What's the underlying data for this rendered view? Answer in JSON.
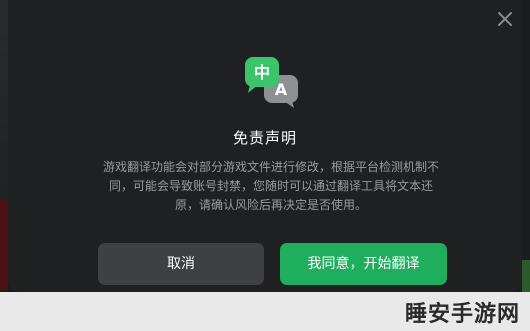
{
  "dialog": {
    "logo_badge_front": "中",
    "logo_badge_back": "A",
    "title": "免责声明",
    "body_lines": [
      "游戏翻译功能会对部分游戏文件进行修改，根据平台检测机制不",
      "同，可能会导致账号封禁，您随时可以通过翻译工具将文本还",
      "原，请确认风险后再决定是否使用。"
    ],
    "cancel_label": "取消",
    "agree_label": "我同意，开始翻译"
  },
  "watermark": {
    "text": "睡安手游网"
  },
  "colors": {
    "dialog_bg": "#1f2022",
    "agree_button": "#1eae5e",
    "cancel_button": "#3f4043",
    "logo_green": "#3cc46a",
    "logo_gray": "#8e9094"
  },
  "icons": {
    "close": "close-icon",
    "logo": "translate-chat-logo-icon"
  }
}
